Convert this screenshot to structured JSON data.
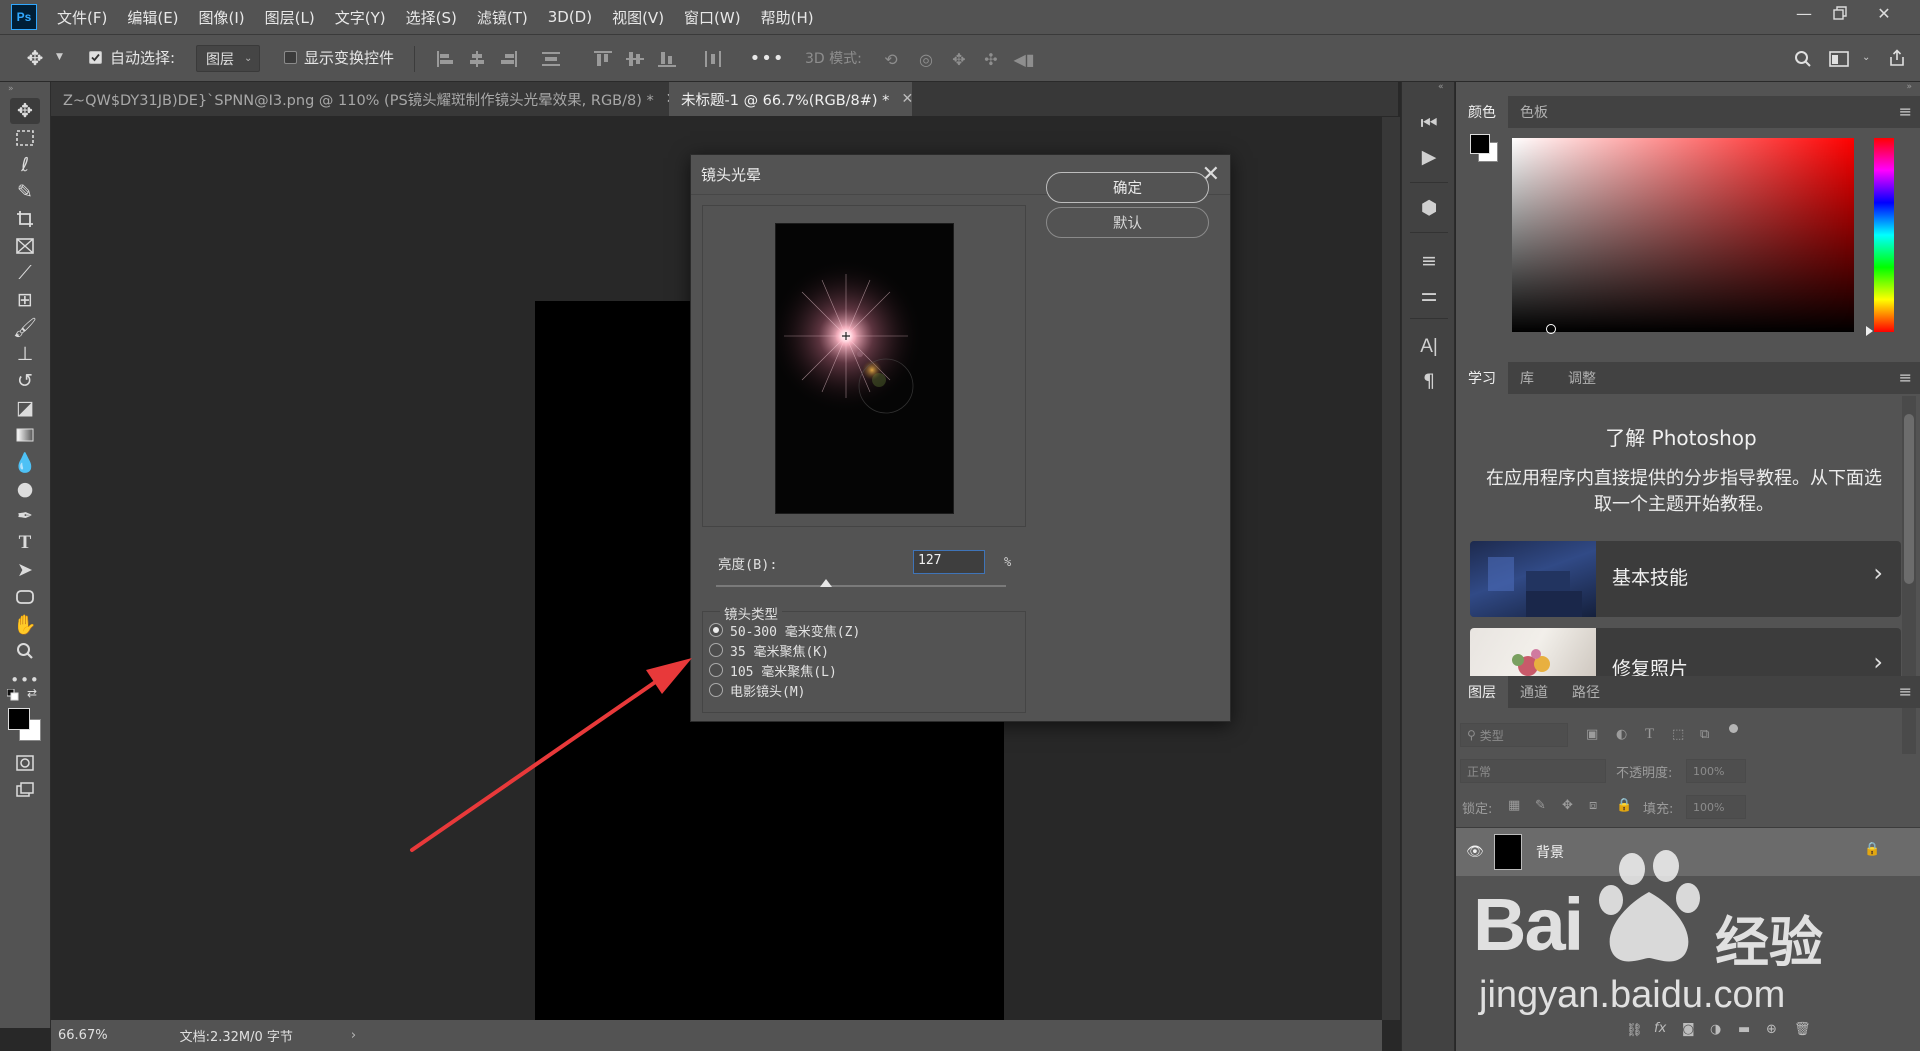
{
  "app": {
    "logo_text": "Ps"
  },
  "menu": [
    "文件(F)",
    "编辑(E)",
    "图像(I)",
    "图层(L)",
    "文字(Y)",
    "选择(S)",
    "滤镜(T)",
    "3D(D)",
    "视图(V)",
    "窗口(W)",
    "帮助(H)"
  ],
  "options_bar": {
    "auto_select_label": "自动选择:",
    "auto_select_target": "图层",
    "show_transform_label": "显示变换控件",
    "mode_3d_label": "3D 模式:"
  },
  "tabs": [
    {
      "label": "Z~QW$DY31JB)DE}`SPNN@I3.png @ 110% (PS镜头耀斑制作镜头光晕效果, RGB/8) *",
      "active": false
    },
    {
      "label": "未标题-1 @ 66.7%(RGB/8#) *",
      "active": true
    }
  ],
  "status": {
    "zoom": "66.67%",
    "doc_info": "文档:2.32M/0 字节",
    "arrow": "›"
  },
  "dialog": {
    "title": "镜头光晕",
    "ok_label": "确定",
    "default_label": "默认",
    "brightness_label": "亮度(B):",
    "brightness_value": "127",
    "brightness_unit": "%",
    "brightness_fraction": 0.38,
    "lens_type_label": "镜头类型",
    "lens_options": [
      "50-300 毫米变焦(Z)",
      "35 毫米聚焦(K)",
      "105 毫米聚焦(L)",
      "电影镜头(M)"
    ],
    "selected_lens_index": 0
  },
  "color_panel": {
    "tabs": [
      "颜色",
      "色板"
    ],
    "hue_color": "#ff0000"
  },
  "learn_panel": {
    "tabs": [
      "学习",
      "库",
      "调整"
    ],
    "title": "了解 Photoshop",
    "description": "在应用程序内直接提供的分步指导教程。从下面选取一个主题开始教程。",
    "cards": [
      "基本技能",
      "修复照片"
    ]
  },
  "layers_panel": {
    "tabs": [
      "图层",
      "通道",
      "路径"
    ],
    "filter_placeholder": "类型",
    "blend_mode": "正常",
    "opacity_label": "不透明度:",
    "opacity_value": "100%",
    "lock_label": "锁定:",
    "fill_label": "填充:",
    "fill_value": "100%",
    "layers": [
      {
        "name": "背景"
      }
    ]
  },
  "watermark": {
    "line1": "Bai",
    "line2": "经验",
    "url": "jingyan.baidu.com"
  },
  "colors": {
    "accent_blue": "#31a8ff",
    "arrow_red": "#e8393a",
    "panel_bg": "#535353",
    "canvas_bg": "#282828"
  }
}
